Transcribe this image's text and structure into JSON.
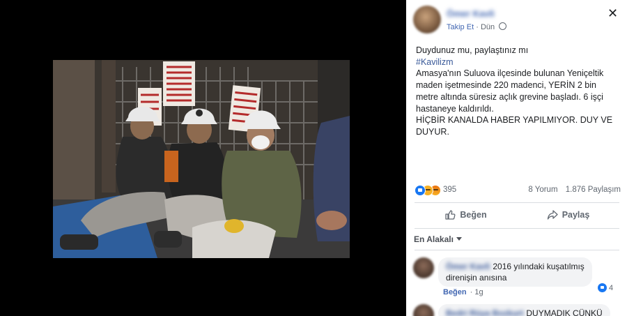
{
  "post": {
    "author": "Ömer Kavli",
    "follow_label": "Takip Et",
    "separator": "·",
    "time": "Dün",
    "close_symbol": "✕",
    "text_lines": [
      "Duydunuz mu, paylaştınız mı",
      "#Kavilizm",
      "Amasya'nın Suluova ilçesinde bulunan Yeniçeltik maden işetmesinde 220 madenci, YERİN 2 bin metre altında süresiz açlık grevine başladı. 6 işçi hastaneye kaldırıldı.",
      "HİÇBİR KANALDA HABER YAPILMIYOR. DUY VE DUYUR."
    ],
    "hashtag_color": "#385898",
    "reaction_count": "395",
    "comments_count": "8 Yorum",
    "shares_count": "1.876 Paylaşım",
    "like_button": "Beğen",
    "share_button": "Paylaş"
  },
  "photo": {
    "sign_text": "BİZ OCAK VE KONVOYLER ÇALIŞIYORUZ SENDİKA VE HAKLARIMIZI YAPILMALI"
  },
  "comments": {
    "sort_label": "En Alakalı",
    "items": [
      {
        "author": "Ömer Kavli",
        "text_line1": "2016 yılındaki kuşatılmış",
        "text_line2": "direnişin anısına",
        "like_label": "Beğen",
        "separator": "·",
        "time": "1g",
        "reaction_count": "4"
      },
      {
        "author": "Bedri Rüya Bozkurt",
        "text_line1": "DUYMADIK ÇÜNKÜ"
      }
    ]
  },
  "colors": {
    "facebook_blue": "#4267b2",
    "link_blue": "#385898",
    "meta_gray": "#606770"
  }
}
